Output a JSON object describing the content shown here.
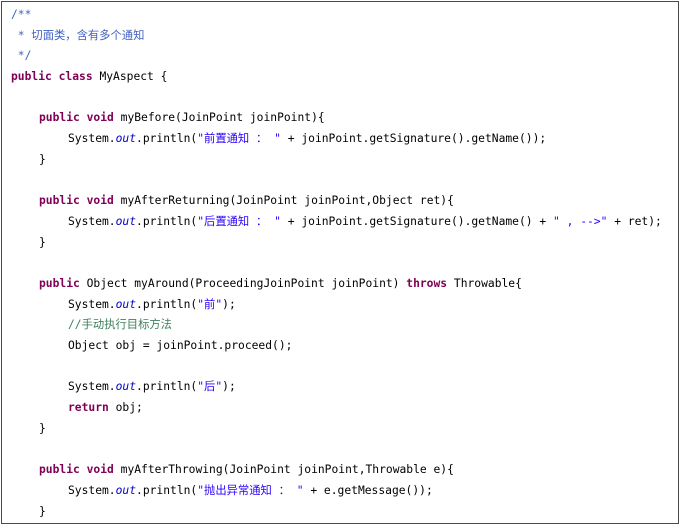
{
  "code": {
    "l1": "/**",
    "l2": " * 切面类，含有多个通知",
    "l3": " */",
    "kw_public": "public",
    "kw_class": "class",
    "kw_void": "void",
    "kw_return": "return",
    "kw_throws": "throws",
    "class_name": " MyAspect {",
    "before_sig": " myBefore(JoinPoint joinPoint){",
    "sysout": "System.",
    "out_field": "out",
    "println_open": ".println(",
    "str_before": "\"前置通知 ： \"",
    "getname_tail": " + joinPoint.getSignature().getName());",
    "close_brace": "}",
    "afterret_sig": " myAfterReturning(JoinPoint joinPoint,Object ret){",
    "str_after": "\"后置通知 ： \"",
    "getname_mid": " + joinPoint.getSignature().getName() + ",
    "str_arrow": "\" , -->\"",
    "ret_tail": " + ret);",
    "around_sig": " Object myAround(ProceedingJoinPoint joinPoint) ",
    "throwable_open": " Throwable{",
    "str_pre": "\"前\"",
    "paren_close": ");",
    "comment_manual": "//手动执行目标方法",
    "proceed_line": "Object obj = joinPoint.proceed();",
    "str_post": "\"后\"",
    "return_tail": " obj;",
    "afterthrow_sig": " myAfterThrowing(JoinPoint joinPoint,Throwable e){",
    "str_throw": "\"抛出异常通知 ： \"",
    "getmsg_tail": " + e.getMessage());"
  }
}
